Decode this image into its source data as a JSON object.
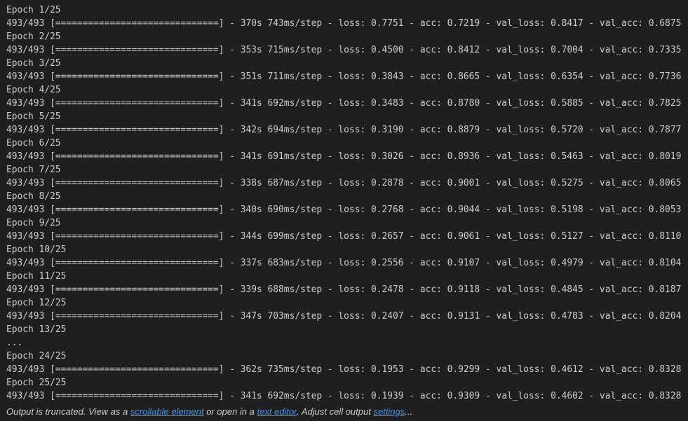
{
  "output": {
    "lines": [
      "Epoch 1/25",
      "493/493 [==============================] - 370s 743ms/step - loss: 0.7751 - acc: 0.7219 - val_loss: 0.8417 - val_acc: 0.6875",
      "Epoch 2/25",
      "493/493 [==============================] - 353s 715ms/step - loss: 0.4500 - acc: 0.8412 - val_loss: 0.7004 - val_acc: 0.7335",
      "Epoch 3/25",
      "493/493 [==============================] - 351s 711ms/step - loss: 0.3843 - acc: 0.8665 - val_loss: 0.6354 - val_acc: 0.7736",
      "Epoch 4/25",
      "493/493 [==============================] - 341s 692ms/step - loss: 0.3483 - acc: 0.8780 - val_loss: 0.5885 - val_acc: 0.7825",
      "Epoch 5/25",
      "493/493 [==============================] - 342s 694ms/step - loss: 0.3190 - acc: 0.8879 - val_loss: 0.5720 - val_acc: 0.7877",
      "Epoch 6/25",
      "493/493 [==============================] - 341s 691ms/step - loss: 0.3026 - acc: 0.8936 - val_loss: 0.5463 - val_acc: 0.8019",
      "Epoch 7/25",
      "493/493 [==============================] - 338s 687ms/step - loss: 0.2878 - acc: 0.9001 - val_loss: 0.5275 - val_acc: 0.8065",
      "Epoch 8/25",
      "493/493 [==============================] - 340s 690ms/step - loss: 0.2768 - acc: 0.9044 - val_loss: 0.5198 - val_acc: 0.8053",
      "Epoch 9/25",
      "493/493 [==============================] - 344s 699ms/step - loss: 0.2657 - acc: 0.9061 - val_loss: 0.5127 - val_acc: 0.8110",
      "Epoch 10/25",
      "493/493 [==============================] - 337s 683ms/step - loss: 0.2556 - acc: 0.9107 - val_loss: 0.4979 - val_acc: 0.8104",
      "Epoch 11/25",
      "493/493 [==============================] - 339s 688ms/step - loss: 0.2478 - acc: 0.9118 - val_loss: 0.4845 - val_acc: 0.8187",
      "Epoch 12/25",
      "493/493 [==============================] - 347s 703ms/step - loss: 0.2407 - acc: 0.9131 - val_loss: 0.4783 - val_acc: 0.8204",
      "Epoch 13/25",
      "...",
      "Epoch 24/25",
      "493/493 [==============================] - 362s 735ms/step - loss: 0.1953 - acc: 0.9299 - val_loss: 0.4612 - val_acc: 0.8328",
      "Epoch 25/25",
      "493/493 [==============================] - 341s 692ms/step - loss: 0.1939 - acc: 0.9309 - val_loss: 0.4602 - val_acc: 0.8328"
    ]
  },
  "footer": {
    "text_before": "Output is truncated. View as a ",
    "link_scrollable": "scrollable element",
    "text_middle": " or open in a ",
    "link_editor": "text editor",
    "text_after_editor": ". Adjust cell output ",
    "link_settings": "settings",
    "text_end": "..."
  },
  "colors": {
    "background": "#1f1f1f",
    "text": "#cccccc",
    "link": "#3794ff"
  }
}
